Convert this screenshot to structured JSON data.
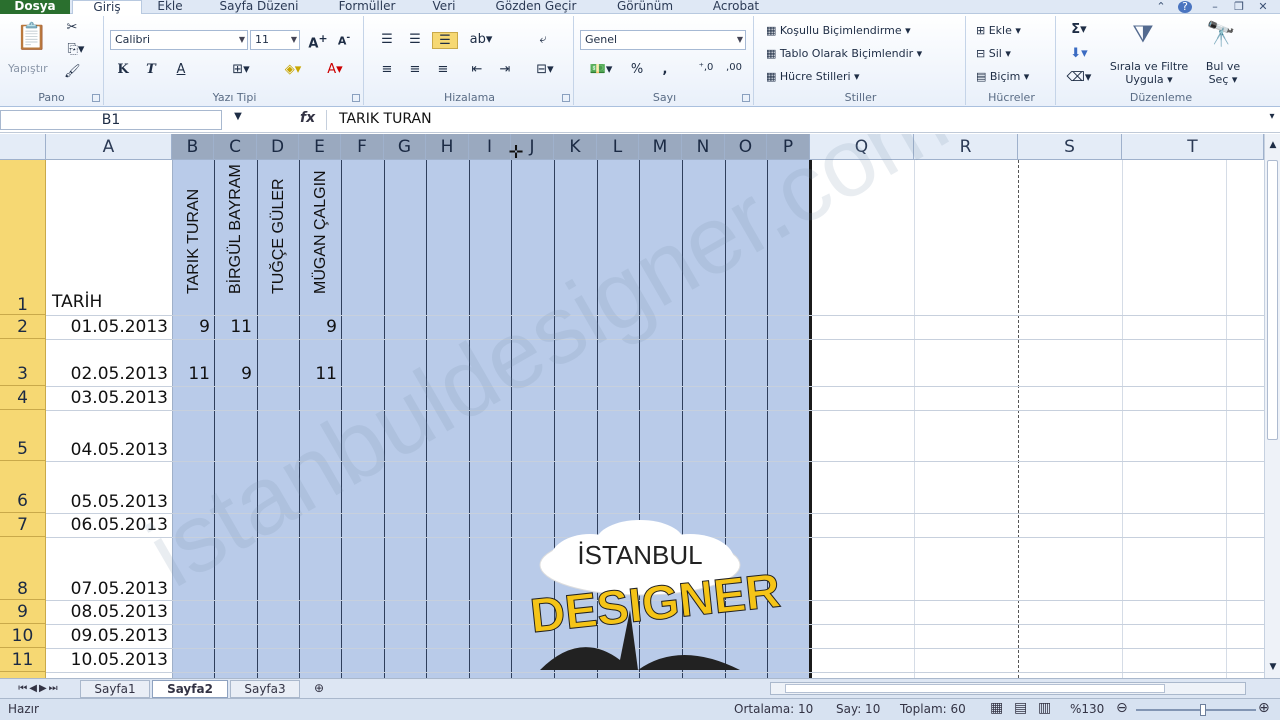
{
  "menu": {
    "tabs": [
      "Dosya",
      "Giriş",
      "Ekle",
      "Sayfa Düzeni",
      "Formüller",
      "Veri",
      "Gözden Geçir",
      "Görünüm",
      "Acrobat"
    ]
  },
  "ribbon": {
    "pano": {
      "label": "Pano",
      "paste": "Yapıştır"
    },
    "font": {
      "label": "Yazı Tipi",
      "name": "Calibri",
      "size": "11",
      "bold": "K",
      "italic": "T",
      "underline": "A"
    },
    "align": {
      "label": "Hizalama"
    },
    "number": {
      "label": "Sayı",
      "format": "Genel",
      "percent": "%",
      "comma": ","
    },
    "styles": {
      "label": "Stiller",
      "conditional": "Koşullu Biçimlendirme",
      "table": "Tablo Olarak Biçimlendir",
      "cell": "Hücre Stilleri"
    },
    "cells": {
      "label": "Hücreler",
      "insert": "Ekle",
      "delete": "Sil",
      "format": "Biçim"
    },
    "editing": {
      "label": "Düzenleme",
      "sort1": "Sırala ve Filtre",
      "sort2": "Uygula",
      "find1": "Bul ve",
      "find2": "Seç"
    }
  },
  "formula": {
    "namebox": "B1",
    "fx": "fx",
    "value": "TARIK TURAN"
  },
  "grid": {
    "columns": [
      "A",
      "B",
      "C",
      "D",
      "E",
      "F",
      "G",
      "H",
      "I",
      "J",
      "K",
      "L",
      "M",
      "N",
      "O",
      "P",
      "Q",
      "R",
      "S",
      "T"
    ],
    "rows": [
      "1",
      "2",
      "3",
      "4",
      "5",
      "6",
      "7",
      "8",
      "9",
      "10",
      "11"
    ],
    "header_a1": "TARİH",
    "names": [
      "TARIK TURAN",
      "BİRGÜL BAYRAM",
      "TUĞÇE GÜLER",
      "MÜGAN ÇALGIN"
    ],
    "dates": [
      "01.05.2013",
      "02.05.2013",
      "03.05.2013",
      "04.05.2013",
      "05.05.2013",
      "06.05.2013",
      "07.05.2013",
      "08.05.2013",
      "09.05.2013",
      "10.05.2013"
    ],
    "values": {
      "r2": {
        "b": "9",
        "c": "11",
        "e": "9"
      },
      "r3": {
        "b": "11",
        "c": "9",
        "e": "11"
      }
    }
  },
  "sheets": {
    "tabs": [
      "Sayfa1",
      "Sayfa2",
      "Sayfa3"
    ],
    "active": "Sayfa2"
  },
  "status": {
    "ready": "Hazır",
    "average": "Ortalama: 10",
    "count": "Say: 10",
    "sum": "Toplam: 60",
    "zoom": "%130"
  },
  "logo": {
    "line1": "İSTANBUL",
    "line2": "DESIGNER"
  },
  "watermark": "istanbuldesigner.com",
  "colors": {
    "selection": "#b9cbe9",
    "row_header": "#f6d873",
    "file_tab": "#2a6f2e"
  }
}
